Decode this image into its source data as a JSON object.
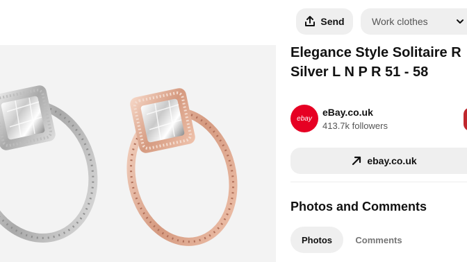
{
  "header": {
    "send_label": "Send",
    "board_select_value": "Work clothes"
  },
  "pin": {
    "title_line1": "Elegance Style Solitaire R",
    "title_line2": "Silver L N P R 51 - 58"
  },
  "source": {
    "avatar_text": "ebay",
    "name": "eBay.co.uk",
    "followers": "413.7k followers",
    "visit_label": "ebay.co.uk"
  },
  "comments_section": {
    "heading": "Photos and Comments",
    "tabs": [
      {
        "label": "Photos",
        "active": true
      },
      {
        "label": "Comments",
        "active": false
      }
    ]
  },
  "icons": {
    "send": "share-upload-icon",
    "board": "chevron-down-icon",
    "visit": "arrow-up-right-icon"
  },
  "colors": {
    "brand_red": "#e60023",
    "follow_button": "#c0272d",
    "button_bg": "#efefef",
    "image_bg": "#f3f3f3"
  }
}
